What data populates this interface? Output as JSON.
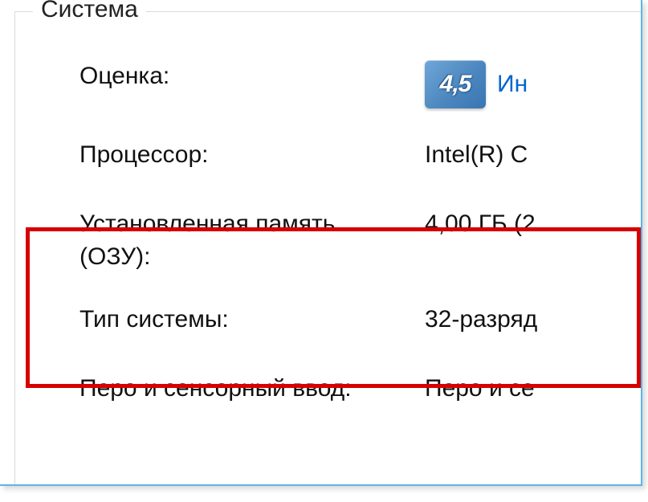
{
  "groupTitle": "Система",
  "rows": {
    "rating": {
      "label": "Оценка:",
      "badgeValue": "4,5",
      "linkText": "Ин"
    },
    "processor": {
      "label": "Процессор:",
      "value": "Intel(R) C"
    },
    "memory": {
      "label": "Установленная память (ОЗУ):",
      "value": "4,00 ГБ (2"
    },
    "systemType": {
      "label": "Тип системы:",
      "value": "32-разряд"
    },
    "penTouch": {
      "label": "Перо и сенсорный ввод:",
      "value": "Перо и се"
    }
  }
}
